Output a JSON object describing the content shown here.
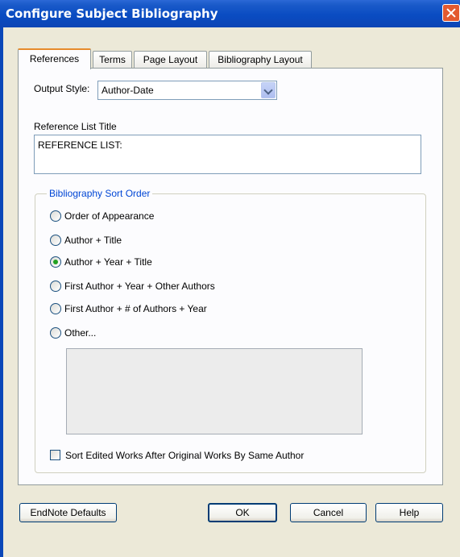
{
  "window": {
    "title": "Configure Subject Bibliography"
  },
  "tabs": [
    {
      "label": "References",
      "active": true
    },
    {
      "label": "Terms",
      "active": false
    },
    {
      "label": "Page Layout",
      "active": false
    },
    {
      "label": "Bibliography Layout",
      "active": false
    }
  ],
  "output_style": {
    "label": "Output Style:",
    "value": "Author-Date"
  },
  "reference_list": {
    "label": "Reference List Title",
    "value": "REFERENCE LIST:"
  },
  "sort_order": {
    "legend": "Bibliography Sort Order",
    "options": [
      {
        "label": "Order of Appearance",
        "checked": false
      },
      {
        "label": "Author + Title",
        "checked": false
      },
      {
        "label": "Author + Year + Title",
        "checked": true
      },
      {
        "label": "First Author + Year + Other Authors",
        "checked": false
      },
      {
        "label": "First Author + # of Authors + Year",
        "checked": false
      },
      {
        "label": "Other...",
        "checked": false
      }
    ]
  },
  "sort_edited": {
    "label": "Sort Edited Works After Original Works By Same Author",
    "checked": false
  },
  "buttons": {
    "defaults": "EndNote Defaults",
    "ok": "OK",
    "cancel": "Cancel",
    "help": "Help"
  },
  "colors": {
    "titlebar": "#0a4cc2",
    "dialog_bg": "#ece9d8",
    "panel_bg": "#fcfcfe",
    "group_legend": "#0046d5",
    "active_tab_accent": "#e68b2c"
  }
}
